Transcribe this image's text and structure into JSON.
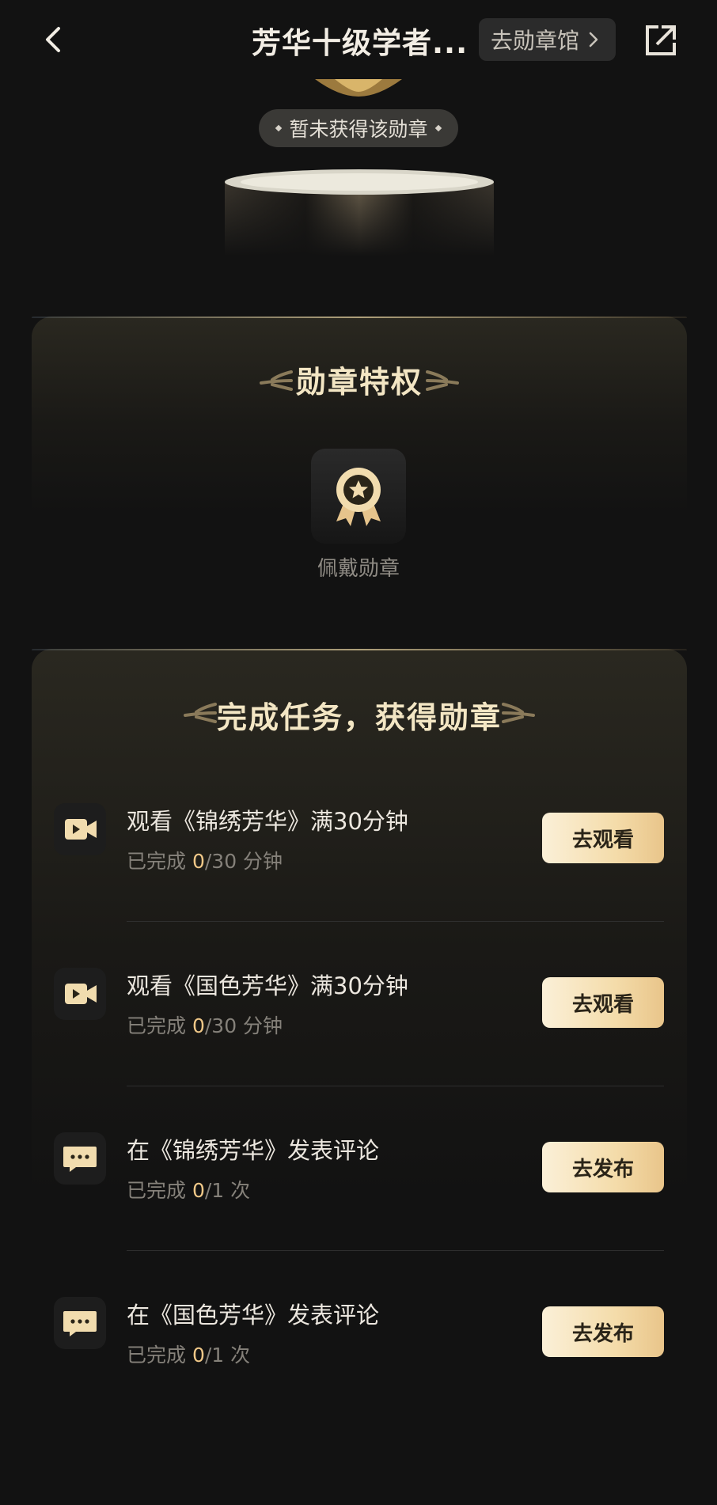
{
  "header": {
    "title": "芳华十级学者...",
    "hall_button": "去勋章馆"
  },
  "medal": {
    "status": "暂未获得该勋章"
  },
  "privileges": {
    "title": "勋章特权",
    "items": [
      {
        "label": "佩戴勋章",
        "icon": "ribbon-medal-icon"
      }
    ]
  },
  "tasks_section": {
    "title": "完成任务，获得勋章",
    "tasks": [
      {
        "name": "观看《锦绣芳华》满30分钟",
        "progress_prefix": "已完成 ",
        "done": "0",
        "total": "/30 分钟",
        "button": "去观看",
        "icon": "video-camera-icon"
      },
      {
        "name": "观看《国色芳华》满30分钟",
        "progress_prefix": "已完成 ",
        "done": "0",
        "total": "/30 分钟",
        "button": "去观看",
        "icon": "video-camera-icon"
      },
      {
        "name": "在《锦绣芳华》发表评论",
        "progress_prefix": "已完成 ",
        "done": "0",
        "total": "/1 次",
        "button": "去发布",
        "icon": "comment-bubble-icon"
      },
      {
        "name": "在《国色芳华》发表评论",
        "progress_prefix": "已完成 ",
        "done": "0",
        "total": "/1 次",
        "button": "去发布",
        "icon": "comment-bubble-icon"
      }
    ]
  },
  "colors": {
    "background": "#121212",
    "accent_gold": "#f0c888",
    "button_gold": "#f4dcaa"
  }
}
